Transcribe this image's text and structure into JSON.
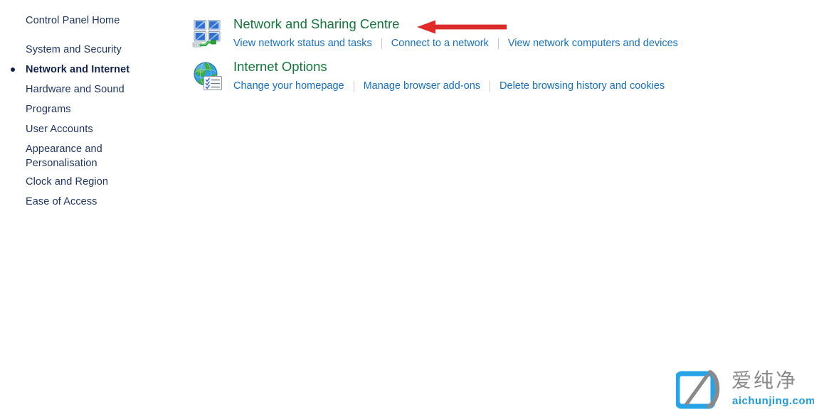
{
  "sidebar": {
    "home_label": "Control Panel Home",
    "selected_index": 1,
    "items": [
      {
        "label": "System and Security"
      },
      {
        "label": "Network and Internet"
      },
      {
        "label": "Hardware and Sound"
      },
      {
        "label": "Programs"
      },
      {
        "label": "User Accounts"
      },
      {
        "label": "Appearance and\nPersonalisation"
      },
      {
        "label": "Clock and Region"
      },
      {
        "label": "Ease of Access"
      }
    ]
  },
  "main": {
    "categories": [
      {
        "icon": "network-sharing-centre-icon",
        "title": "Network and Sharing Centre",
        "links": [
          "View network status and tasks",
          "Connect to a network",
          "View network computers and devices"
        ]
      },
      {
        "icon": "internet-options-globe-icon",
        "title": "Internet Options",
        "links": [
          "Change your homepage",
          "Manage browser add-ons",
          "Delete browsing history and cookies"
        ]
      }
    ]
  },
  "annotation": {
    "arrow": "red-left-arrow",
    "color": "#e02b29"
  },
  "watermark": {
    "logo": "aichunjing-logo-icon",
    "cn_text": "爱纯净",
    "domain_text": "aichunjing.com",
    "cn_color": "#8a8a8a",
    "domain_color": "#1c9ae0"
  },
  "colors": {
    "background": "#ffffff",
    "sidebar_link": "#1f3566",
    "sidebar_selected": "#11224f",
    "category_title": "#14773b",
    "category_link": "#1570c4",
    "separator": "#c8c8c8"
  }
}
